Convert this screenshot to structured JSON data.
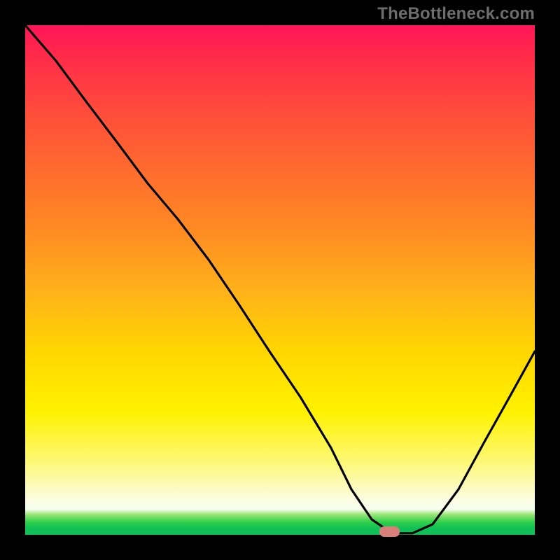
{
  "watermark": "TheBottleneck.com",
  "colors": {
    "background": "#000000",
    "curve": "#000000",
    "marker": "#d87f79",
    "gradient_stops": [
      "#ff1557",
      "#ff2a49",
      "#ff4f3a",
      "#ff6a2e",
      "#ff8a23",
      "#ffb11a",
      "#ffd600",
      "#fff200",
      "#fdf97a",
      "#fcfce0",
      "#f6ffef",
      "#9be678",
      "#2fd04a",
      "#10c157",
      "#0fbf58"
    ]
  },
  "chart_data": {
    "type": "line",
    "title": "",
    "xlabel": "",
    "ylabel": "",
    "x": [
      0.0,
      0.06,
      0.12,
      0.18,
      0.24,
      0.3,
      0.36,
      0.42,
      0.48,
      0.54,
      0.6,
      0.64,
      0.68,
      0.72,
      0.76,
      0.8,
      0.85,
      0.9,
      0.95,
      1.0
    ],
    "values": [
      1.0,
      0.93,
      0.85,
      0.77,
      0.69,
      0.62,
      0.54,
      0.45,
      0.36,
      0.27,
      0.17,
      0.09,
      0.03,
      0.003,
      0.003,
      0.02,
      0.09,
      0.18,
      0.27,
      0.36
    ],
    "xlim": [
      0,
      1
    ],
    "ylim": [
      0,
      1
    ],
    "marker": {
      "x": 0.715,
      "y": 0.003
    },
    "notes": "Background spans a vertical red→orange→yellow→pale→green gradient. Curve descends from top-left, hits a minimum near x≈0.71 at the narrow green band at the bottom, then rises toward the right edge to roughly one-third height. Axes and tick labels are not visible; values are normalized 0–1."
  }
}
